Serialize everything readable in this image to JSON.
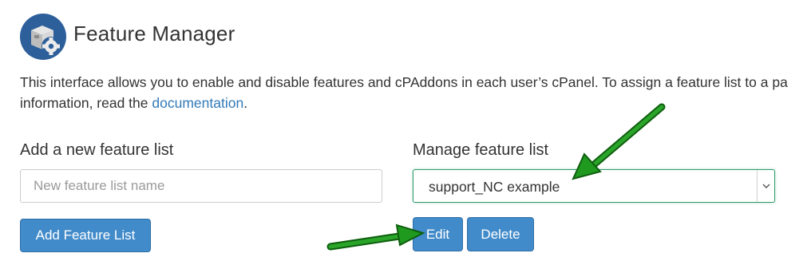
{
  "header": {
    "title": "Feature Manager",
    "icon": "feature-manager-icon"
  },
  "description": {
    "text_before_link": "This interface allows you to enable and disable features and cPAddons in each user’s cPanel. To assign a feature list to a pa",
    "text_line2": "information, read the ",
    "link_text": "documentation",
    "text_after_link": "."
  },
  "add_section": {
    "label": "Add a new feature list",
    "input_placeholder": "New feature list name",
    "input_value": "",
    "button_label": "Add Feature List"
  },
  "manage_section": {
    "label": "Manage feature list",
    "selected_value": "support_NC example",
    "edit_label": "Edit",
    "delete_label": "Delete"
  },
  "colors": {
    "primary_button": "#428bca",
    "link": "#337ab7",
    "select_focus_border": "#2e9b6b",
    "annotation_arrow": "#1f9a1f"
  }
}
